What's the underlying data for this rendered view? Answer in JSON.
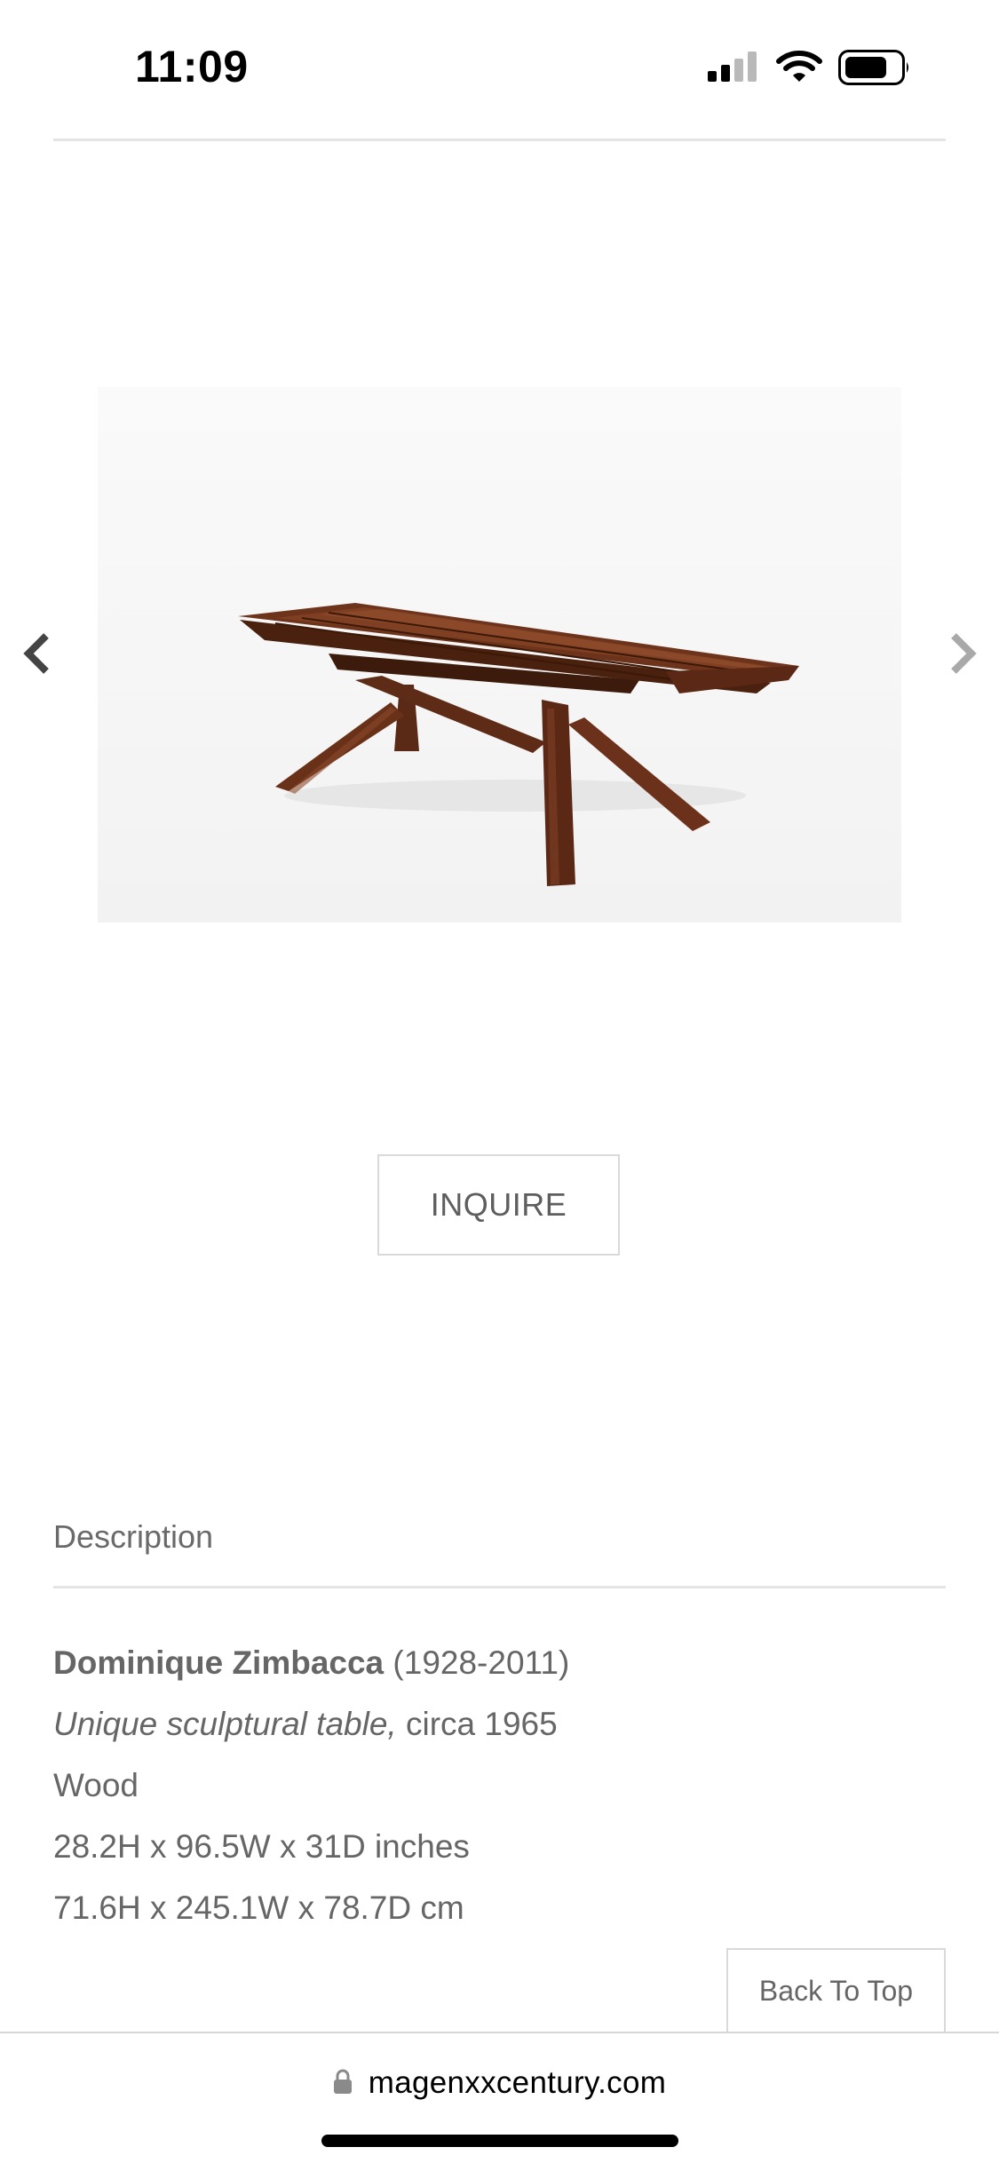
{
  "status_bar": {
    "time": "11:09"
  },
  "gallery": {
    "prev_icon": "chevron-left-icon",
    "next_icon": "chevron-right-icon",
    "image_subject": "wooden sculptural table"
  },
  "actions": {
    "inquire_label": "INQUIRE",
    "back_to_top_label": "Back To Top"
  },
  "description": {
    "heading": "Description",
    "artist": "Dominique Zimbacca",
    "artist_dates": " (1928-2011)",
    "title": "Unique sculptural table,",
    "date": " circa 1965",
    "material": "Wood",
    "dimensions_in": "28.2H x 96.5W x 31D inches",
    "dimensions_cm": "71.6H x 245.1W x 78.7D cm"
  },
  "browser": {
    "url": "magenxxcentury.com",
    "lock_icon": "lock-icon"
  },
  "colors": {
    "text": "#666666",
    "border": "#d9d9d9",
    "wood": "#5a2a14"
  }
}
